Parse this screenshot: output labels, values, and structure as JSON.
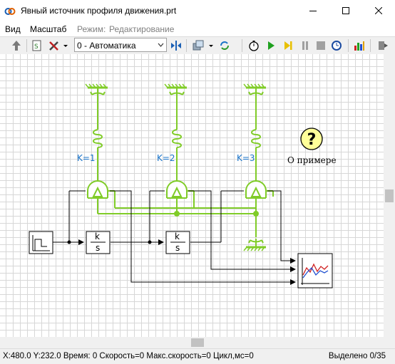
{
  "window": {
    "title": "Явный источник профиля движения.prt"
  },
  "menu": {
    "items": [
      "Вид",
      "Масштаб"
    ],
    "mode_label": "Режим:",
    "mode_value": "Редактирование"
  },
  "toolbar": {
    "combo_value": "0 - Автоматика"
  },
  "diagram": {
    "gains": [
      "K=1",
      "K=2",
      "K=3"
    ],
    "about_label": "О примере",
    "integrator_numerator": "k",
    "integrator_denominator": "s"
  },
  "status": {
    "left": "X:480.0  Y:232.0 Время: 0 Скорость=0 Макс.скорость=0 Цикл,мс=0",
    "right": "Выделено 0/35"
  },
  "colors": {
    "mechanical": "#80cc28",
    "label_blue": "#1a73c8",
    "grid": "#d7d7d7",
    "about_fill": "#ffff99"
  }
}
